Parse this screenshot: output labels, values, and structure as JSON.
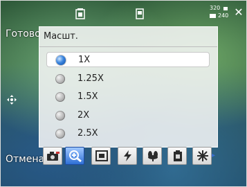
{
  "softkeys": {
    "left": "Готово",
    "right": "Отмена"
  },
  "status": {
    "resolution_top": "320",
    "resolution_bottom": "240"
  },
  "zoom_menu": {
    "title": "Масшт.",
    "options": [
      {
        "label": "1X",
        "selected": true
      },
      {
        "label": "1.25X",
        "selected": false
      },
      {
        "label": "1.5X",
        "selected": false
      },
      {
        "label": "2X",
        "selected": false
      },
      {
        "label": "2.5X",
        "selected": false
      }
    ]
  },
  "toolbar": {
    "items": [
      {
        "name": "camera-mode-icon",
        "active": false
      },
      {
        "name": "zoom-icon",
        "active": true
      },
      {
        "name": "frame-icon",
        "active": false
      },
      {
        "name": "flash-icon",
        "active": false
      },
      {
        "name": "macro-icon",
        "active": false
      },
      {
        "name": "memory-icon",
        "active": false
      },
      {
        "name": "effects-icon",
        "active": false
      }
    ]
  },
  "colors": {
    "accent": "#2f70d6",
    "panel_bg": "#f8f8f8"
  }
}
